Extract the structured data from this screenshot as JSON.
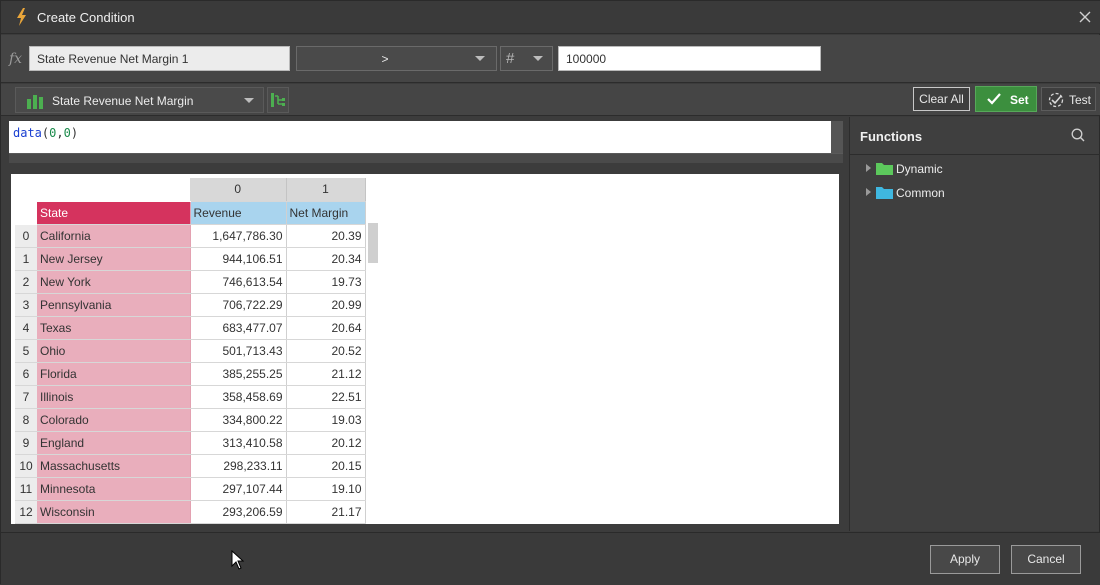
{
  "window": {
    "title": "Create Condition",
    "title_icon": "lightning-icon",
    "close_icon": "close-icon"
  },
  "condition": {
    "fx_label": "fx",
    "name_value": "State Revenue Net Margin 1",
    "operator_value": ">",
    "type_value": "#",
    "compare_value": "100000"
  },
  "toolbar": {
    "source_value": "State Revenue Net Margin",
    "source_icon": "bar-chart-icon",
    "clear_label": "Clear All",
    "set_label": "Set",
    "test_label": "Test"
  },
  "editor": {
    "fn_name": "data",
    "open_paren": "(",
    "arg1": "0",
    "comma": ",",
    "arg2": "0",
    "close_paren": ")"
  },
  "grid": {
    "col_numbers": [
      "0",
      "1"
    ],
    "headers": {
      "state": "State",
      "revenue": "Revenue",
      "net_margin": "Net Margin"
    },
    "rows": [
      {
        "idx": "0",
        "state": "California",
        "revenue": "1,647,786.30",
        "net_margin": "20.39"
      },
      {
        "idx": "1",
        "state": "New Jersey",
        "revenue": "944,106.51",
        "net_margin": "20.34"
      },
      {
        "idx": "2",
        "state": "New York",
        "revenue": "746,613.54",
        "net_margin": "19.73"
      },
      {
        "idx": "3",
        "state": "Pennsylvania",
        "revenue": "706,722.29",
        "net_margin": "20.99"
      },
      {
        "idx": "4",
        "state": "Texas",
        "revenue": "683,477.07",
        "net_margin": "20.64"
      },
      {
        "idx": "5",
        "state": "Ohio",
        "revenue": "501,713.43",
        "net_margin": "20.52"
      },
      {
        "idx": "6",
        "state": "Florida",
        "revenue": "385,255.25",
        "net_margin": "21.12"
      },
      {
        "idx": "7",
        "state": "Illinois",
        "revenue": "358,458.69",
        "net_margin": "22.51"
      },
      {
        "idx": "8",
        "state": "Colorado",
        "revenue": "334,800.22",
        "net_margin": "19.03"
      },
      {
        "idx": "9",
        "state": "England",
        "revenue": "313,410.58",
        "net_margin": "20.12"
      },
      {
        "idx": "10",
        "state": "Massachusetts",
        "revenue": "298,233.11",
        "net_margin": "20.15"
      },
      {
        "idx": "11",
        "state": "Minnesota",
        "revenue": "297,107.44",
        "net_margin": "19.10"
      },
      {
        "idx": "12",
        "state": "Wisconsin",
        "revenue": "293,206.59",
        "net_margin": "21.17"
      }
    ]
  },
  "functions": {
    "title": "Functions",
    "items": [
      {
        "label": "Dynamic",
        "folder_color": "#5cc85c"
      },
      {
        "label": "Common",
        "folder_color": "#3fb7e0"
      }
    ]
  },
  "footer": {
    "apply_label": "Apply",
    "cancel_label": "Cancel"
  },
  "colors": {
    "set_green": "#3c8f3e",
    "state_header": "#d5335e",
    "state_cell": "#e9aebc",
    "measure_header": "#a9d4ee"
  }
}
